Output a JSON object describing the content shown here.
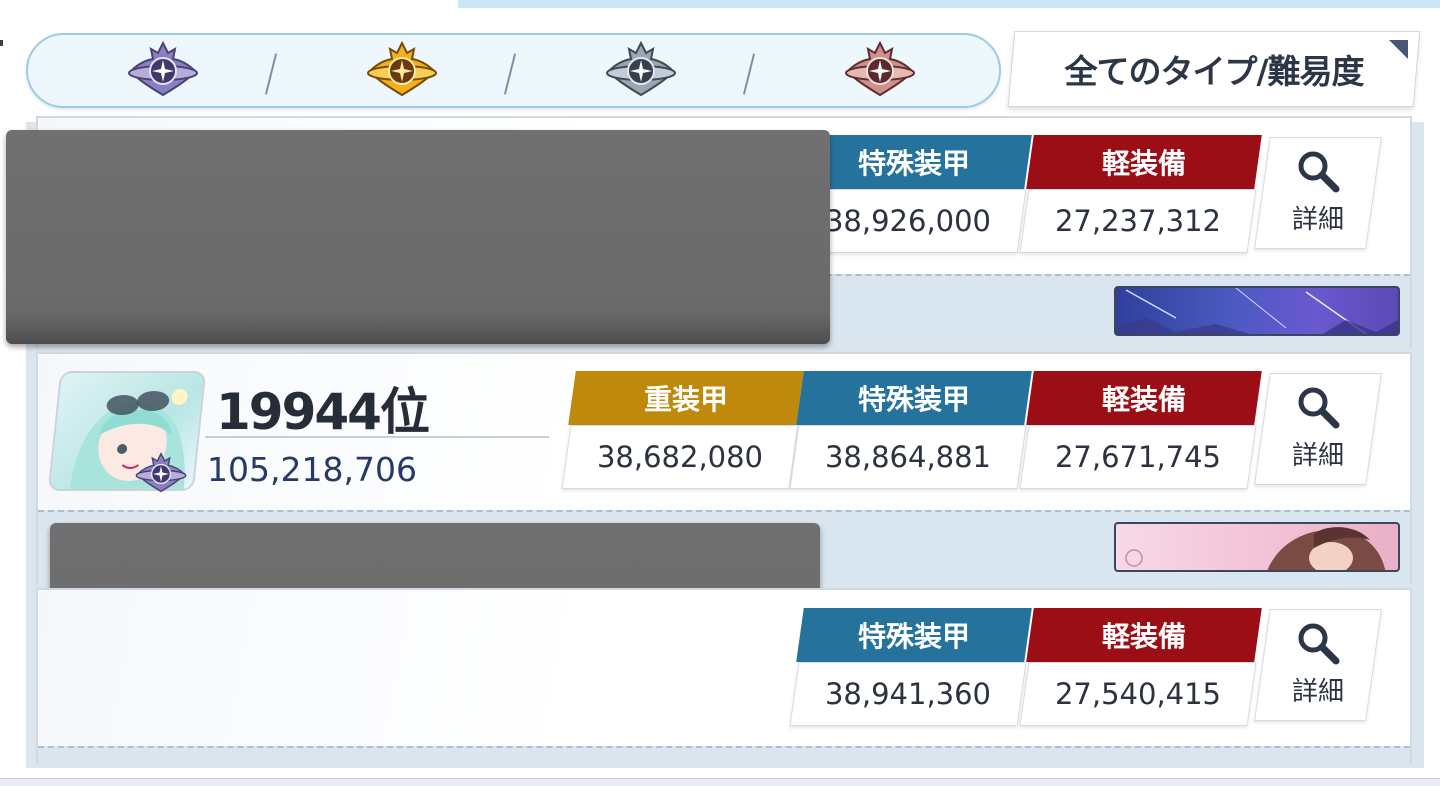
{
  "filter": {
    "emblems": [
      {
        "name": "purple-class-emblem",
        "color": "#8a7fc0"
      },
      {
        "name": "gold-class-emblem",
        "color": "#e3a21d"
      },
      {
        "name": "silver-class-emblem",
        "color": "#8a96a6"
      },
      {
        "name": "bronze-class-emblem",
        "color": "#c98984"
      }
    ],
    "dropdown_label": "全てのタイプ/難易度"
  },
  "columns": {
    "heavy": "重装甲",
    "special": "特殊装甲",
    "light": "軽装備"
  },
  "detail_label": "詳細",
  "entries": [
    {
      "special_score": "38,926,000",
      "light_score": "27,237,312"
    },
    {
      "rank": "19944位",
      "total_score": "105,218,706",
      "heavy_score": "38,682,080",
      "special_score": "38,864,881",
      "light_score": "27,671,745"
    },
    {
      "special_score": "38,941,360",
      "light_score": "27,540,415"
    }
  ],
  "colors": {
    "heavy": "#bf8a0c",
    "special": "#25739c",
    "light": "#9b0e16",
    "accent": "#c9e7f6"
  }
}
